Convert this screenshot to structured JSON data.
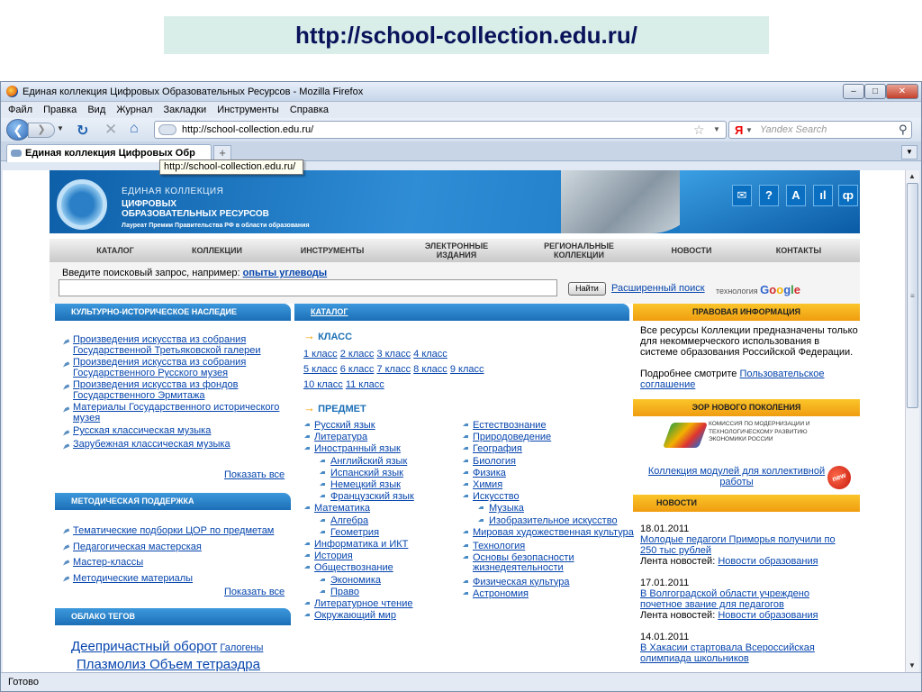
{
  "slide": {
    "title": "http://school-collection.edu.ru/"
  },
  "window": {
    "title": "Единая коллекция Цифровых Образовательных Ресурсов - Mozilla Firefox"
  },
  "menu": [
    "Файл",
    "Правка",
    "Вид",
    "Журнал",
    "Закладки",
    "Инструменты",
    "Справка"
  ],
  "address": {
    "url": "http://school-collection.edu.ru/"
  },
  "search_bar": {
    "engine": "Я",
    "placeholder": "Yandex Search"
  },
  "tab": {
    "label": "Единая коллекция Цифровых Обр",
    "tooltip": "http://school-collection.edu.ru/"
  },
  "status": "Готово",
  "site": {
    "logo": {
      "line1": "ЕДИНАЯ КОЛЛЕКЦИЯ",
      "line2": "ЦИФРОВЫХ",
      "line3": "ОБРАЗОВАТЕЛЬНЫХ РЕСУРСОВ",
      "line4": "Лауреат Премии Правительства РФ в области образования"
    },
    "header_icons": [
      "✉",
      "?",
      "A",
      "ıl",
      "ȹ"
    ],
    "nav": [
      "КАТАЛОГ",
      "КОЛЛЕКЦИИ",
      "ИНСТРУМЕНТЫ",
      "ЭЛЕКТРОННЫЕ ИЗДАНИЯ",
      "РЕГИОНАЛЬНЫЕ КОЛЛЕКЦИИ",
      "НОВОСТИ",
      "КОНТАКТЫ"
    ],
    "search": {
      "label": "Введите поисковый запрос, например:",
      "example": "опыты углеводы",
      "button": "Найти",
      "advanced": "Расширенный поиск",
      "tech": "технология",
      "google": [
        "G",
        "o",
        "o",
        "g",
        "l",
        "e"
      ]
    },
    "left": {
      "heritage": {
        "title": "КУЛЬТУРНО-ИСТОРИЧЕСКОЕ НАСЛЕДИЕ",
        "items": [
          "Произведения искусства из собрания Государственной Третьяковской галереи",
          "Произведения искусства из собрания Государственного Русского музея",
          "Произведения искусства из фондов Государственного Эрмитажа",
          "Материалы Государственного исторического музея",
          "Русская классическая музыка",
          "Зарубежная классическая музыка"
        ],
        "show_all": "Показать все"
      },
      "methodical": {
        "title": "МЕТОДИЧЕСКАЯ ПОДДЕРЖКА",
        "items": [
          "Тематические подборки ЦОР по предметам",
          "Педагогическая мастерская",
          "Мастер-классы",
          "Методические материалы"
        ],
        "show_all": "Показать все"
      },
      "tags": {
        "title": "ОБЛАКО ТЕГОВ",
        "big": "Деепричастный оборот",
        "small": "Галогены",
        "line2": "Плазмолиз Объем тетраэдра"
      }
    },
    "catalog": {
      "title": "КАТАЛОГ",
      "class_heading": "КЛАСС",
      "classes": [
        [
          "1 класс",
          "2 класс",
          "3 класс",
          "4 класс"
        ],
        [
          "5 класс",
          "6 класс",
          "7 класс",
          "8 класс",
          "9 класс"
        ],
        [
          "10 класс",
          "11 класс"
        ]
      ],
      "subject_heading": "ПРЕДМЕТ",
      "col1": [
        {
          "t": "Русский язык",
          "l": 1
        },
        {
          "t": "Литература",
          "l": 1
        },
        {
          "t": "Иностранный язык",
          "l": 1
        },
        {
          "t": "Английский язык",
          "l": 2
        },
        {
          "t": "Испанский язык",
          "l": 2
        },
        {
          "t": "Немецкий язык",
          "l": 2
        },
        {
          "t": "Французский язык",
          "l": 2
        },
        {
          "t": "Математика",
          "l": 1
        },
        {
          "t": "Алгебра",
          "l": 2
        },
        {
          "t": "Геометрия",
          "l": 2
        },
        {
          "t": "Информатика и ИКТ",
          "l": 1
        },
        {
          "t": "История",
          "l": 1
        },
        {
          "t": "Обществознание",
          "l": 1
        },
        {
          "t": "Экономика",
          "l": 2
        },
        {
          "t": "Право",
          "l": 2
        },
        {
          "t": "Литературное чтение",
          "l": 1
        },
        {
          "t": "Окружающий мир",
          "l": 1
        }
      ],
      "col2": [
        {
          "t": "Естествознание",
          "l": 1
        },
        {
          "t": "Природоведение",
          "l": 1
        },
        {
          "t": "География",
          "l": 1
        },
        {
          "t": "Биология",
          "l": 1
        },
        {
          "t": "Физика",
          "l": 1
        },
        {
          "t": "Химия",
          "l": 1
        },
        {
          "t": "Искусство",
          "l": 1
        },
        {
          "t": "Музыка",
          "l": 2
        },
        {
          "t": "Изобразительное искусство",
          "l": 2
        },
        {
          "t": "Мировая художественная культура",
          "l": 1
        },
        {
          "t": "Технология",
          "l": 1
        },
        {
          "t": "Основы безопасности жизнедеятельности",
          "l": 1
        },
        {
          "t": "Физическая культура",
          "l": 1
        },
        {
          "t": "Астрономия",
          "l": 1
        }
      ]
    },
    "right": {
      "legal": {
        "title": "ПРАВОВАЯ ИНФОРМАЦИЯ",
        "text": "Все ресурсы Коллекции предназначены только для некоммерческого использования в системе образования Российской Федерации.",
        "more": "Подробнее смотрите",
        "link": "Пользовательское соглашение"
      },
      "eor": {
        "title": "ЭОР НОВОГО ПОКОЛЕНИЯ",
        "commission": "КОМИССИЯ ПО МОДЕРНИЗАЦИИ И ТЕХНОЛОГИЧЕСКОМУ РАЗВИТИЮ ЭКОНОМИКИ РОССИИ",
        "link": "Коллекция модулей для коллективной работы",
        "badge": "new"
      },
      "news": {
        "title": "НОВОСТИ",
        "feed_label": "Лента новостей:",
        "items": [
          {
            "date": "18.01.2011",
            "text": "Молодые педагоги Приморья получили по 250 тыс рублей",
            "feed": "Новости образования"
          },
          {
            "date": "17.01.2011",
            "text": "В Волгоградской области учреждено почетное звание для педагогов",
            "feed": "Новости образования"
          },
          {
            "date": "14.01.2011",
            "text": "В Хакасии стартовала Всероссийская олимпиада школьников",
            "feed": ""
          }
        ]
      }
    }
  }
}
